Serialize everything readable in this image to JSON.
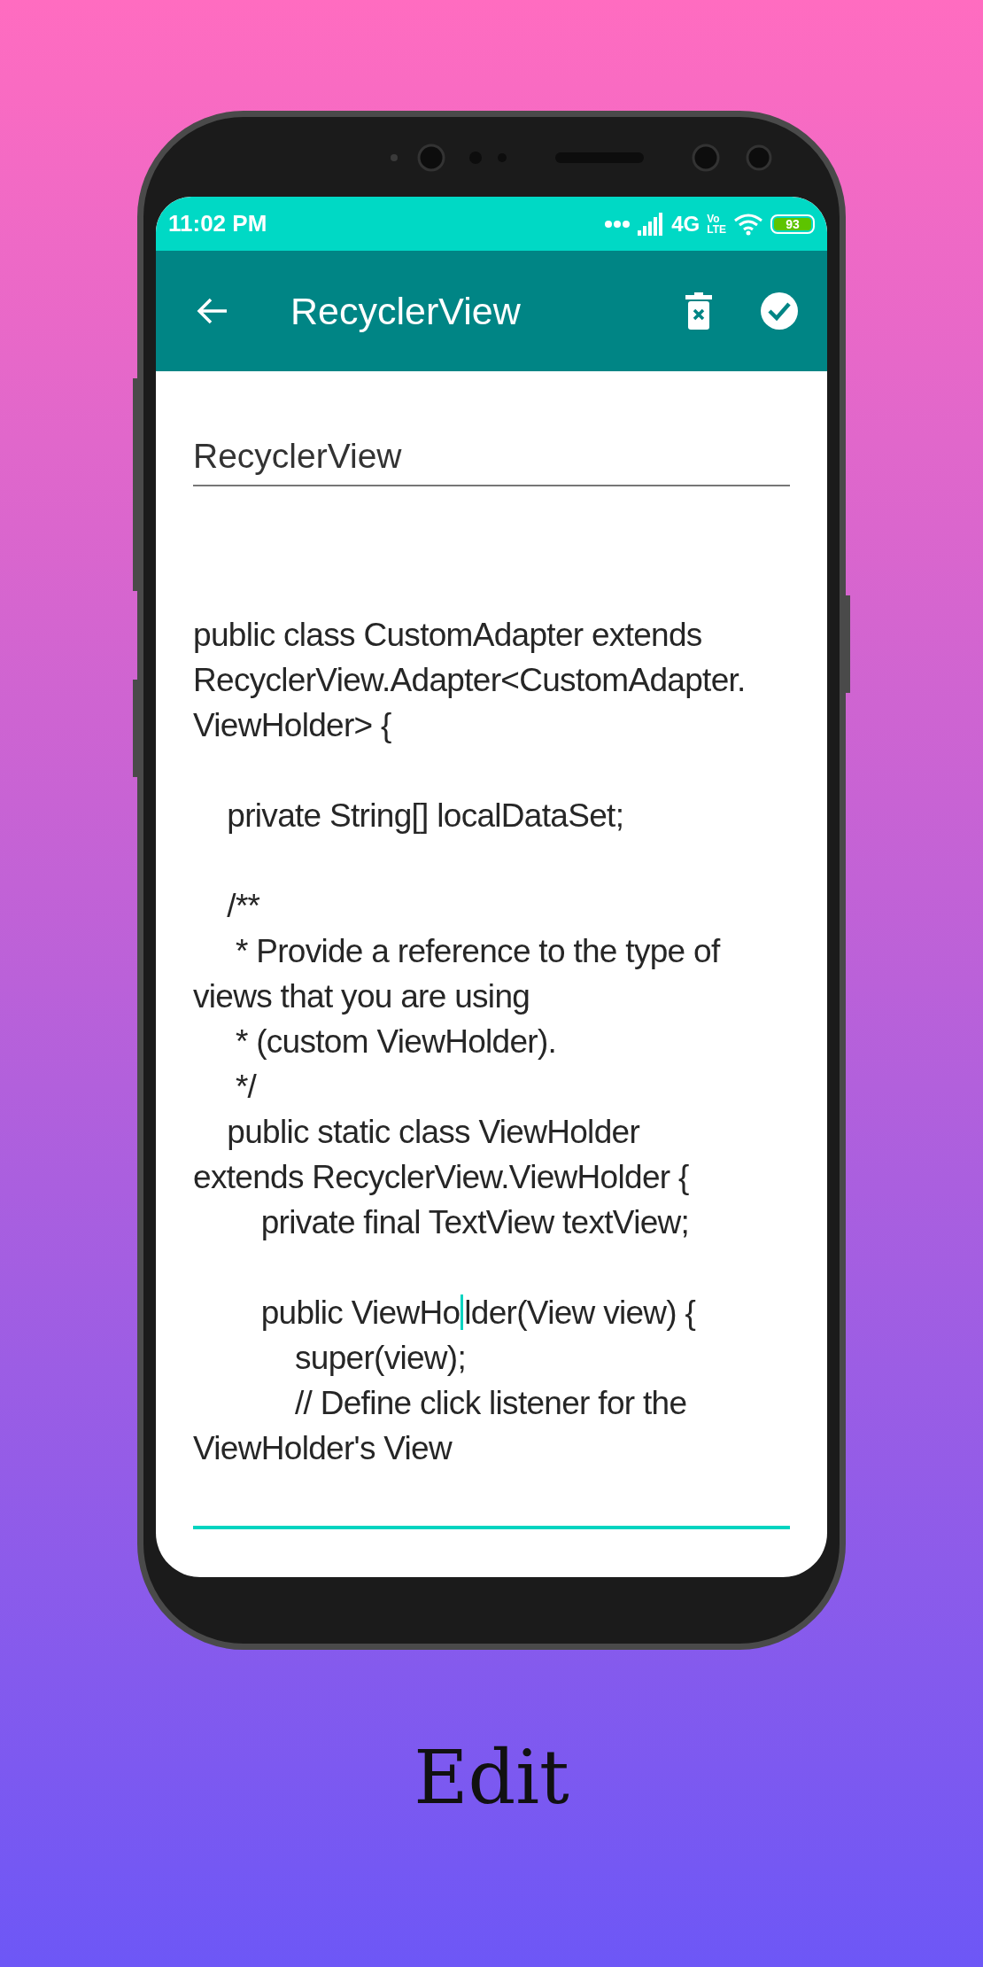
{
  "status_bar": {
    "time": "11:02 PM",
    "network": "4G",
    "volte_top": "Vo",
    "volte_bottom": "LTE",
    "battery": "93"
  },
  "app_bar": {
    "title": "RecyclerView"
  },
  "title_field": {
    "value": "RecyclerView",
    "focused": false
  },
  "note_body": {
    "focused": true,
    "paragraphs": [
      {
        "lines": [
          {
            "text": "public class CustomAdapter extends"
          },
          {
            "text": "RecyclerView.Adapter<CustomAdapter."
          },
          {
            "text": "ViewHolder> {"
          }
        ]
      },
      {
        "lines": [
          {
            "text": "    private String[] localDataSet;"
          }
        ]
      },
      {
        "lines": [
          {
            "text": "    /**"
          },
          {
            "text": "     * Provide a reference to the type of"
          },
          {
            "text": "views that you are using"
          },
          {
            "text": "     * (custom ViewHolder)."
          },
          {
            "text": "     */"
          },
          {
            "text": "    public static class ViewHolder"
          },
          {
            "text": "extends RecyclerView.ViewHolder {"
          },
          {
            "text": "        private final TextView textView;"
          }
        ]
      },
      {
        "lines": [
          {
            "segments": [
              "        public ViewHo",
              "lder(View view) {"
            ]
          },
          {
            "text": "            super(view);"
          },
          {
            "text": "            // Define click listener for the"
          },
          {
            "text": "ViewHolder's View"
          }
        ]
      }
    ]
  },
  "caption": "Edit"
}
